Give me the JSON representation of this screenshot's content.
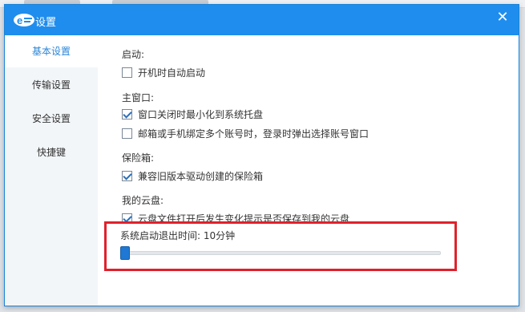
{
  "window": {
    "title": "设置",
    "close_symbol": "✕",
    "logo_icon": "cloud-e-logo",
    "accent_color": "#1f8ded"
  },
  "sidebar": {
    "items": [
      {
        "label": "基本设置",
        "active": true
      },
      {
        "label": "传输设置",
        "active": false
      },
      {
        "label": "安全设置",
        "active": false
      },
      {
        "label": "快捷键",
        "active": false
      }
    ]
  },
  "startup": {
    "title": "启动:",
    "auto_start": {
      "label": "开机时自动启动",
      "checked": false
    }
  },
  "main_window": {
    "title": "主窗口:",
    "minimize_to_tray": {
      "label": "窗口关闭时最小化到系统托盘",
      "checked": true
    },
    "multi_account_popup": {
      "label": "邮箱或手机绑定多个账号时，登录时弹出选择账号窗口",
      "checked": false
    }
  },
  "vault": {
    "title": "保险箱:",
    "legacy_driver": {
      "label": "兼容旧版本驱动创建的保险箱",
      "checked": true
    }
  },
  "my_cloud": {
    "title": "我的云盘:",
    "file_change_prompt": {
      "label": "云盘文件打开后发生变化提示是否保存到我的云盘",
      "checked": true
    }
  },
  "auto_exit": {
    "label": "系统启动退出时间:  10分钟",
    "level": 0.0,
    "highlight_color": "#e0212b"
  }
}
